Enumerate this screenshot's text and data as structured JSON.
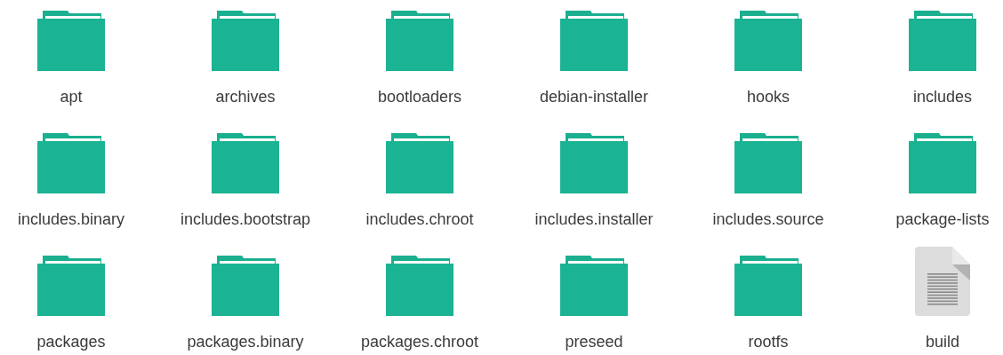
{
  "items": [
    {
      "name": "apt",
      "kind": "folder"
    },
    {
      "name": "archives",
      "kind": "folder"
    },
    {
      "name": "bootloaders",
      "kind": "folder"
    },
    {
      "name": "debian-installer",
      "kind": "folder"
    },
    {
      "name": "hooks",
      "kind": "folder"
    },
    {
      "name": "includes",
      "kind": "folder"
    },
    {
      "name": "includes.binary",
      "kind": "folder"
    },
    {
      "name": "includes.bootstrap",
      "kind": "folder"
    },
    {
      "name": "includes.chroot",
      "kind": "folder"
    },
    {
      "name": "includes.installer",
      "kind": "folder"
    },
    {
      "name": "includes.source",
      "kind": "folder"
    },
    {
      "name": "package-lists",
      "kind": "folder"
    },
    {
      "name": "packages",
      "kind": "folder"
    },
    {
      "name": "packages.binary",
      "kind": "folder"
    },
    {
      "name": "packages.chroot",
      "kind": "folder"
    },
    {
      "name": "preseed",
      "kind": "folder"
    },
    {
      "name": "rootfs",
      "kind": "folder"
    },
    {
      "name": "build",
      "kind": "file"
    }
  ]
}
